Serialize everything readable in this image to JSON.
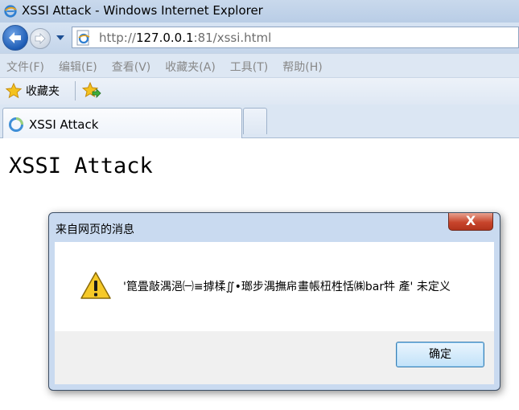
{
  "window": {
    "title": "XSSI Attack - Windows Internet Explorer"
  },
  "navbar": {
    "url_prefix": "http://",
    "url_host": "127.0.0.1",
    "url_rest": ":81/xssi.html"
  },
  "menubar": {
    "items": [
      "文件(F)",
      "编辑(E)",
      "查看(V)",
      "收藏夹(A)",
      "工具(T)",
      "帮助(H)"
    ]
  },
  "favorites": {
    "label": "收藏夹"
  },
  "tabs": [
    {
      "label": "XSSI Attack"
    }
  ],
  "page": {
    "heading": "XSSI Attack"
  },
  "dialog": {
    "title": "来自网页的消息",
    "close_label": "X",
    "message": "'箟畳敲湡浥㈠≡摢楺∬•瑯步湡撫帍畫帳杻栍恬㈱bar牪 產' 未定义",
    "ok_label": "确定"
  },
  "colors": {
    "accent": "#1d5cb5",
    "close_red": "#c8452c",
    "dialog_frame": "#c9daf0"
  }
}
